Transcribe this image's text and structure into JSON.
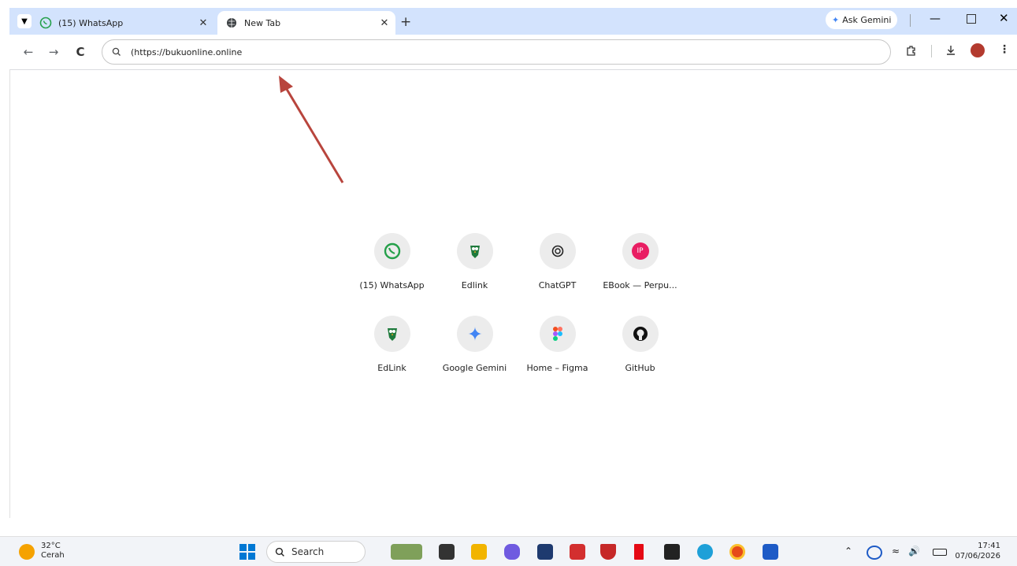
{
  "browser": {
    "tabs": [
      {
        "title": "(15) WhatsApp",
        "active": false,
        "favicon": "whatsapp-icon"
      },
      {
        "title": "New Tab",
        "active": true,
        "favicon": "globe-icon"
      }
    ],
    "new_tab_symbol": "+",
    "ask_gemini_label": "Ask Gemini",
    "window_controls": [
      "minimize",
      "maximize",
      "close"
    ],
    "address_bar": {
      "value": "(https://bukuonline.online"
    },
    "nav": {
      "back": "←",
      "forward": "→",
      "reload": "C"
    }
  },
  "shortcuts": [
    {
      "label": "(15) WhatsApp",
      "icon": "whatsapp-icon",
      "color": "#25d366"
    },
    {
      "label": "Edlink",
      "icon": "edlink-icon",
      "color": "#1e7a3c"
    },
    {
      "label": "ChatGPT",
      "icon": "chatgpt-icon",
      "color": "#222222"
    },
    {
      "label": "EBook — Perpu...",
      "icon": "ip-badge-icon",
      "badge": "IP",
      "color": "#e91e63"
    },
    {
      "label": "EdLink",
      "icon": "edlink-icon",
      "color": "#1e7a3c"
    },
    {
      "label": "Google Gemini",
      "icon": "gemini-icon",
      "color": "#4285f4"
    },
    {
      "label": "Home – Figma",
      "icon": "figma-icon",
      "color": "#a259ff"
    },
    {
      "label": "GitHub",
      "icon": "github-icon",
      "color": "#111111"
    }
  ],
  "taskbar": {
    "weather": {
      "temp": "32°C",
      "condition": "Cerah"
    },
    "search_label": "Search",
    "clock": {
      "time": "17:41",
      "date": "07/06/2026"
    },
    "apps": [
      "widgets-icon",
      "file-explorer-icon",
      "folder-icon",
      "copilot-icon",
      "store-icon",
      "l-app-icon",
      "mcafee-icon",
      "netflix-icon",
      "dropbox-icon",
      "edge-icon",
      "chrome-icon",
      "word-icon"
    ]
  }
}
